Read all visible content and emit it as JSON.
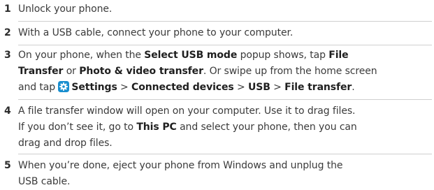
{
  "steps": [
    {
      "number": "1",
      "lines": [
        [
          {
            "t": "Unlock your phone."
          }
        ]
      ]
    },
    {
      "number": "2",
      "lines": [
        [
          {
            "t": "With a USB cable, connect your phone to your computer."
          }
        ]
      ]
    },
    {
      "number": "3",
      "lines": [
        [
          {
            "t": "On your phone, when the "
          },
          {
            "t": "Select USB mode",
            "b": true
          },
          {
            "t": " popup shows, tap "
          },
          {
            "t": "File",
            "b": true
          }
        ],
        [
          {
            "t": "Transfer",
            "b": true
          },
          {
            "t": " or "
          },
          {
            "t": "Photo & video transfer",
            "b": true
          },
          {
            "t": ". Or swipe up from the home screen"
          }
        ],
        [
          {
            "t": "and tap "
          },
          {
            "icon": "settings-gear-icon"
          },
          {
            "t": "Settings",
            "b": true
          },
          {
            "t": " > "
          },
          {
            "t": "Connected devices",
            "b": true
          },
          {
            "t": " > "
          },
          {
            "t": "USB",
            "b": true
          },
          {
            "t": " > "
          },
          {
            "t": "File transfer",
            "b": true
          },
          {
            "t": "."
          }
        ]
      ]
    },
    {
      "number": "4",
      "lines": [
        [
          {
            "t": "A file transfer window will open on your computer. Use it to drag files."
          }
        ],
        [
          {
            "t": "If you don’t see it, go to "
          },
          {
            "t": "This PC",
            "b": true
          },
          {
            "t": " and select your phone, then you can"
          }
        ],
        [
          {
            "t": "drag and drop files."
          }
        ]
      ]
    },
    {
      "number": "5",
      "lines": [
        [
          {
            "t": "When you’re done, eject your phone from Windows and unplug the"
          }
        ],
        [
          {
            "t": "USB cable."
          }
        ]
      ]
    }
  ],
  "icon_color": "#1a8fcf"
}
